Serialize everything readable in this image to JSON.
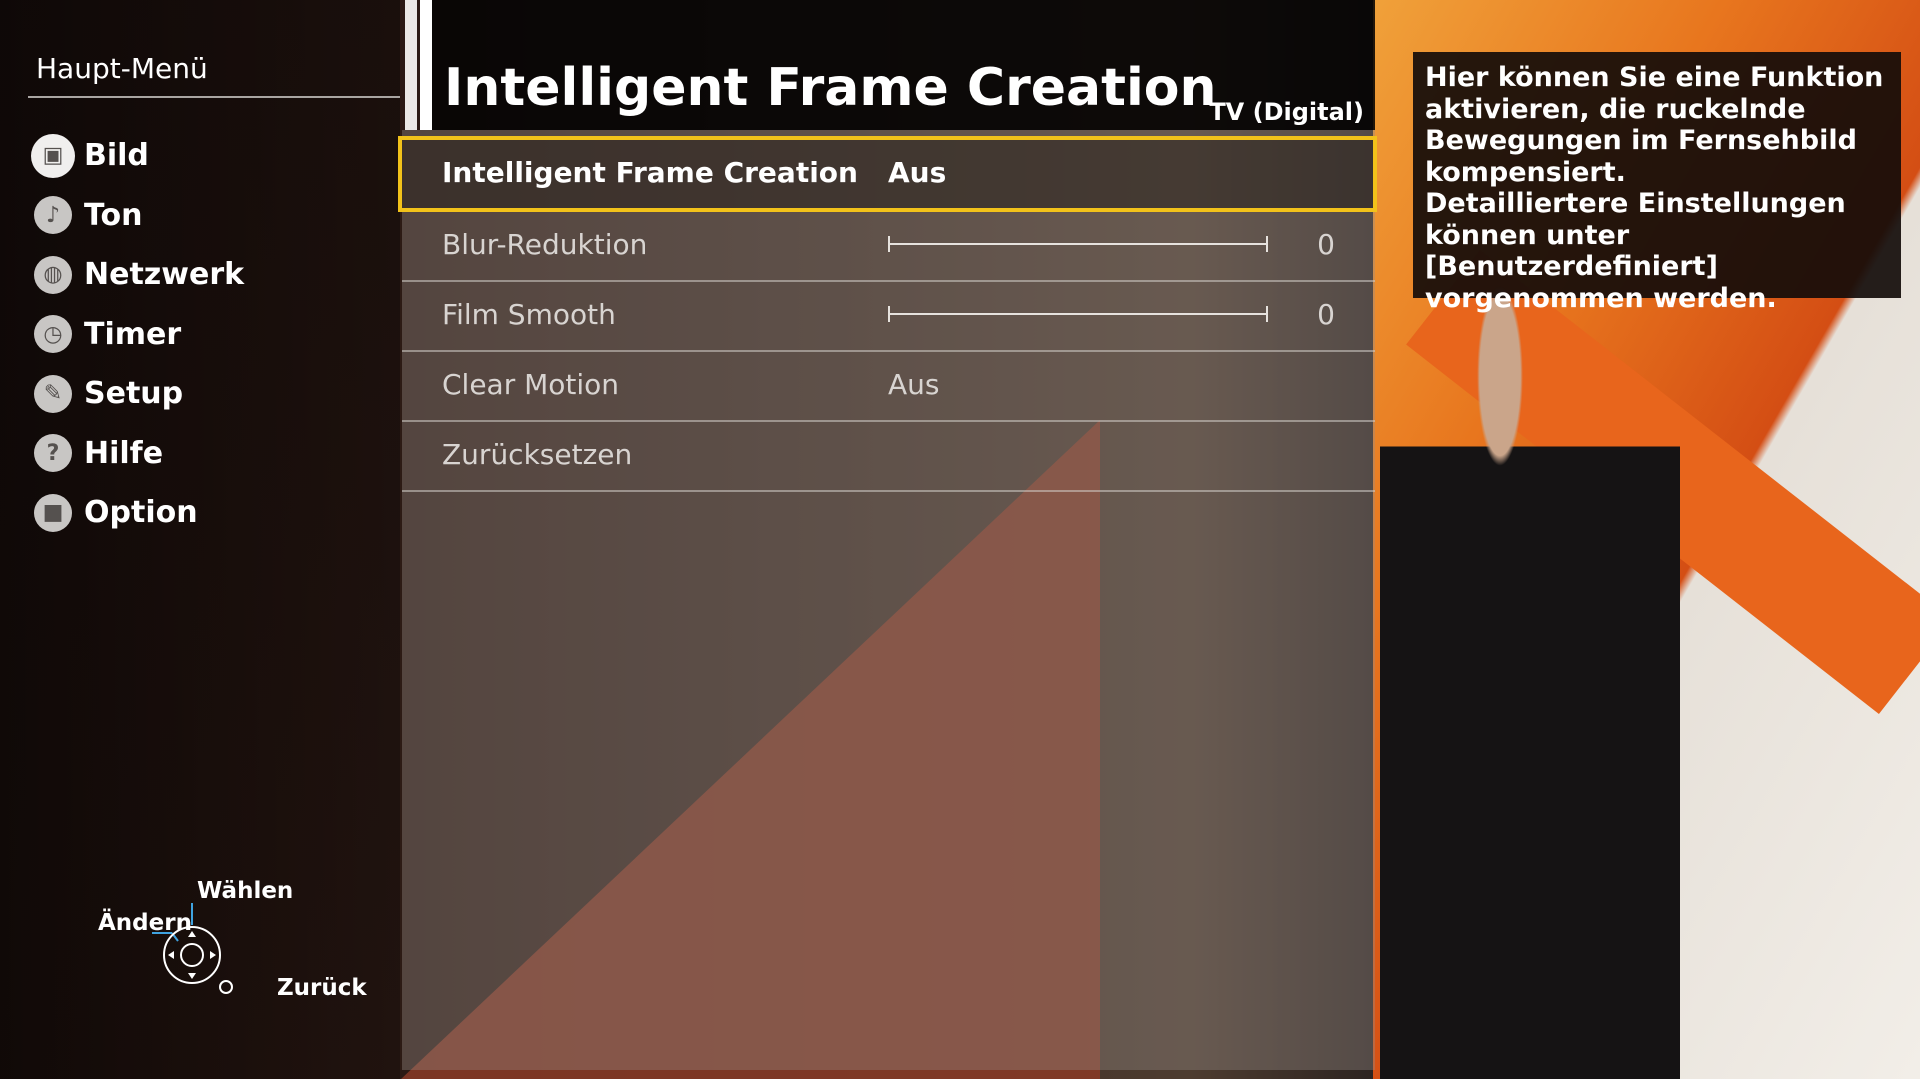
{
  "sidebar": {
    "title": "Haupt-Menü",
    "items": [
      {
        "label": "Bild",
        "icon": "tv-icon",
        "glyph": "▣"
      },
      {
        "label": "Ton",
        "icon": "music-note-icon",
        "glyph": "♪"
      },
      {
        "label": "Netzwerk",
        "icon": "globe-icon",
        "glyph": "◍"
      },
      {
        "label": "Timer",
        "icon": "clock-icon",
        "glyph": "◷"
      },
      {
        "label": "Setup",
        "icon": "wrench-icon",
        "glyph": "✎"
      },
      {
        "label": "Hilfe",
        "icon": "question-icon",
        "glyph": "?"
      },
      {
        "label": "Option",
        "icon": "option-square-icon",
        "glyph": "■"
      }
    ]
  },
  "remote_help": {
    "change": "Ändern",
    "select": "Wählen",
    "back": "Zurück"
  },
  "panel": {
    "title": "Intelligent Frame Creation",
    "source": "TV (Digital)",
    "rows": {
      "ifc": {
        "label": "Intelligent Frame Creation",
        "value": "Aus"
      },
      "blur": {
        "label": "Blur-Reduktion",
        "value": "0"
      },
      "film": {
        "label": "Film Smooth",
        "value": "0"
      },
      "clear": {
        "label": "Clear Motion",
        "value": "Aus"
      },
      "reset": {
        "label": "Zurücksetzen"
      }
    }
  },
  "help": {
    "text": "Hier können Sie eine Funktion\naktivieren, die ruckelnde\nBewegungen im Fernsehbild\nkompensiert.\nDetailliertere Einstellungen\nkönnen unter [Benutzerdefiniert]\nvorgenommen werden."
  },
  "colors": {
    "selection": "#f2c21a",
    "accent_orange": "#e8761e"
  }
}
